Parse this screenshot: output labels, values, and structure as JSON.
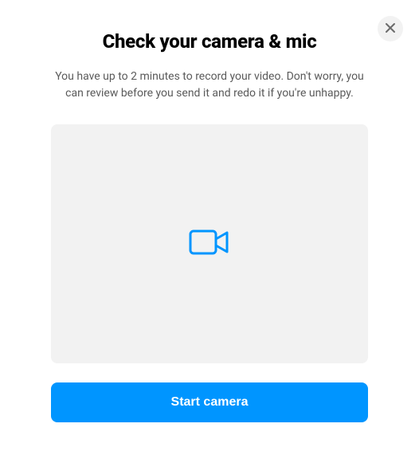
{
  "modal": {
    "title": "Check your camera & mic",
    "description": "You have up to 2 minutes to record your video. Don't worry, you can review before you send it and redo it if you're unhappy.",
    "start_button_label": "Start camera"
  },
  "colors": {
    "primary": "#0095ff",
    "background": "#ffffff",
    "preview_bg": "#f2f2f2",
    "text_muted": "#5a5a5a"
  }
}
